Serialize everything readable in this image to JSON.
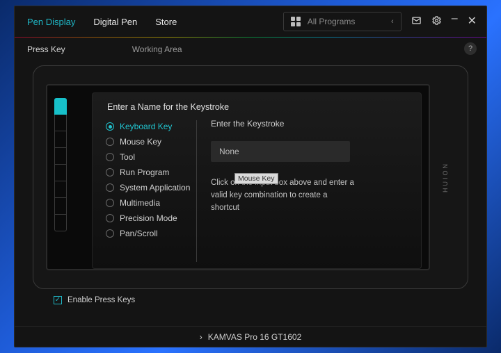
{
  "tabs": {
    "pen_display": "Pen Display",
    "digital_pen": "Digital Pen",
    "store": "Store"
  },
  "programs": {
    "label": "All Programs"
  },
  "subtabs": {
    "press_key": "Press Key",
    "working_area": "Working Area"
  },
  "brand": "HUION",
  "panel": {
    "title": "Enter a Name for the Keystroke",
    "options": {
      "keyboard_key": "Keyboard Key",
      "mouse_key": "Mouse Key",
      "tool": "Tool",
      "run_program": "Run Program",
      "system_application": "System Application",
      "multimedia": "Multimedia",
      "precision_mode": "Precision Mode",
      "pan_scroll": "Pan/Scroll"
    },
    "right_title": "Enter the Keystroke",
    "input_value": "None",
    "hint": "Click on the input box above and enter a valid key combination to create a shortcut"
  },
  "tooltip": "Mouse Key",
  "enable_label": "Enable Press Keys",
  "device": "KAMVAS Pro 16 GT1602",
  "help": "?"
}
